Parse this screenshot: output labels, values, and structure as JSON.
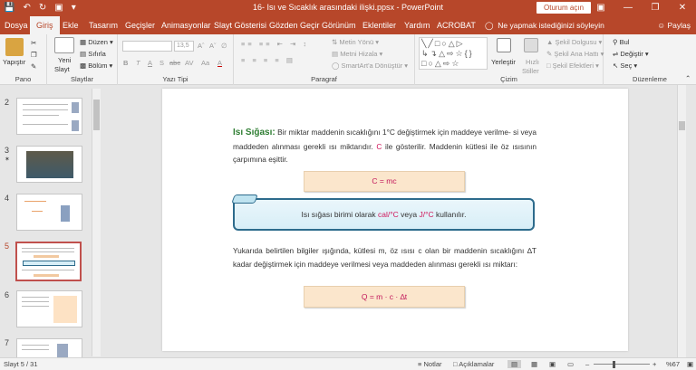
{
  "window": {
    "title": "16- Isı ve Sıcaklık arasındaki ilişki.ppsx  -  PowerPoint",
    "signin_label": "Oturum açın"
  },
  "tabs": [
    "Dosya",
    "Giriş",
    "Ekle",
    "Tasarım",
    "Geçişler",
    "Animasyonlar",
    "Slayt Gösterisi",
    "Gözden Geçir",
    "Görünüm",
    "Eklentiler",
    "Yardım",
    "ACROBAT"
  ],
  "tell_me": "Ne yapmak istediğinizi söyleyin",
  "share": "Paylaş",
  "ribbon": {
    "pano": {
      "label": "Pano",
      "paste": "Yapıştır"
    },
    "slaytlar": {
      "label": "Slaytlar",
      "new_slide": "Yeni",
      "new_slide2": "Slayt",
      "layout": "Düzen",
      "reset": "Sıfırla",
      "section": "Bölüm"
    },
    "yazi_tipi": {
      "label": "Yazı Tipi",
      "size": "13,5",
      "bold": "B",
      "italic": "T",
      "underline": "A",
      "strike": "S",
      "shadow": "abc",
      "spacing": "AV",
      "case": "Aa",
      "fontcolor": "A"
    },
    "paragraf": {
      "label": "Paragraf",
      "text_dir": "Metin Yönü",
      "align_text": "Metni Hizala",
      "smartart": "SmartArt'a Dönüştür"
    },
    "cizim": {
      "label": "Çizim",
      "arrange": "Yerleştir",
      "quick_styles": "Hızlı",
      "quick_styles2": "Stiller",
      "fill": "Şekil Dolgusu",
      "outline": "Şekil Ana Hattı",
      "effects": "Şekil Efektleri"
    },
    "duzenleme": {
      "label": "Düzenleme",
      "find": "Bul",
      "replace": "Değiştir",
      "select": "Seç"
    }
  },
  "thumbnails": [
    {
      "number": "2"
    },
    {
      "number": "3"
    },
    {
      "number": "4"
    },
    {
      "number": "5"
    },
    {
      "number": "6"
    },
    {
      "number": "7"
    }
  ],
  "slide": {
    "heading": "Isı Sığası:",
    "para1_a": " Bir miktar maddenin sıcaklığını 1°C değiştirmek için maddeye verilme- si veya maddeden alınması gerekli ısı miktarıdır. ",
    "para1_c": "C",
    "para1_b": " ile gösterilir. Maddenin kütlesi ile öz ısısının çarpımına eşittir.",
    "formula1": "C = mc",
    "info_a": "Isı sığası birimi olarak ",
    "info_unit1": "cal/°C",
    "info_b": " veya ",
    "info_unit2": "J/°C",
    "info_c": " kullanılır.",
    "para2": "Yukarıda belirtilen bilgiler ışığında, kütlesi m, öz ısısı c olan bir maddenin sıcaklığını ∆T kadar değiştirmek için maddeye verilmesi veya maddeden alınması gerekli ısı miktarı:",
    "formula2": "Q = m · c · ∆t"
  },
  "status": {
    "slide_counter": "Slayt 5 / 31",
    "notes": "Notlar",
    "comments": "Açıklamalar",
    "zoom": "%67"
  },
  "colors": {
    "accent": "#b7472a",
    "heading_green": "#2e7d32",
    "highlight_red": "#d0155a"
  }
}
